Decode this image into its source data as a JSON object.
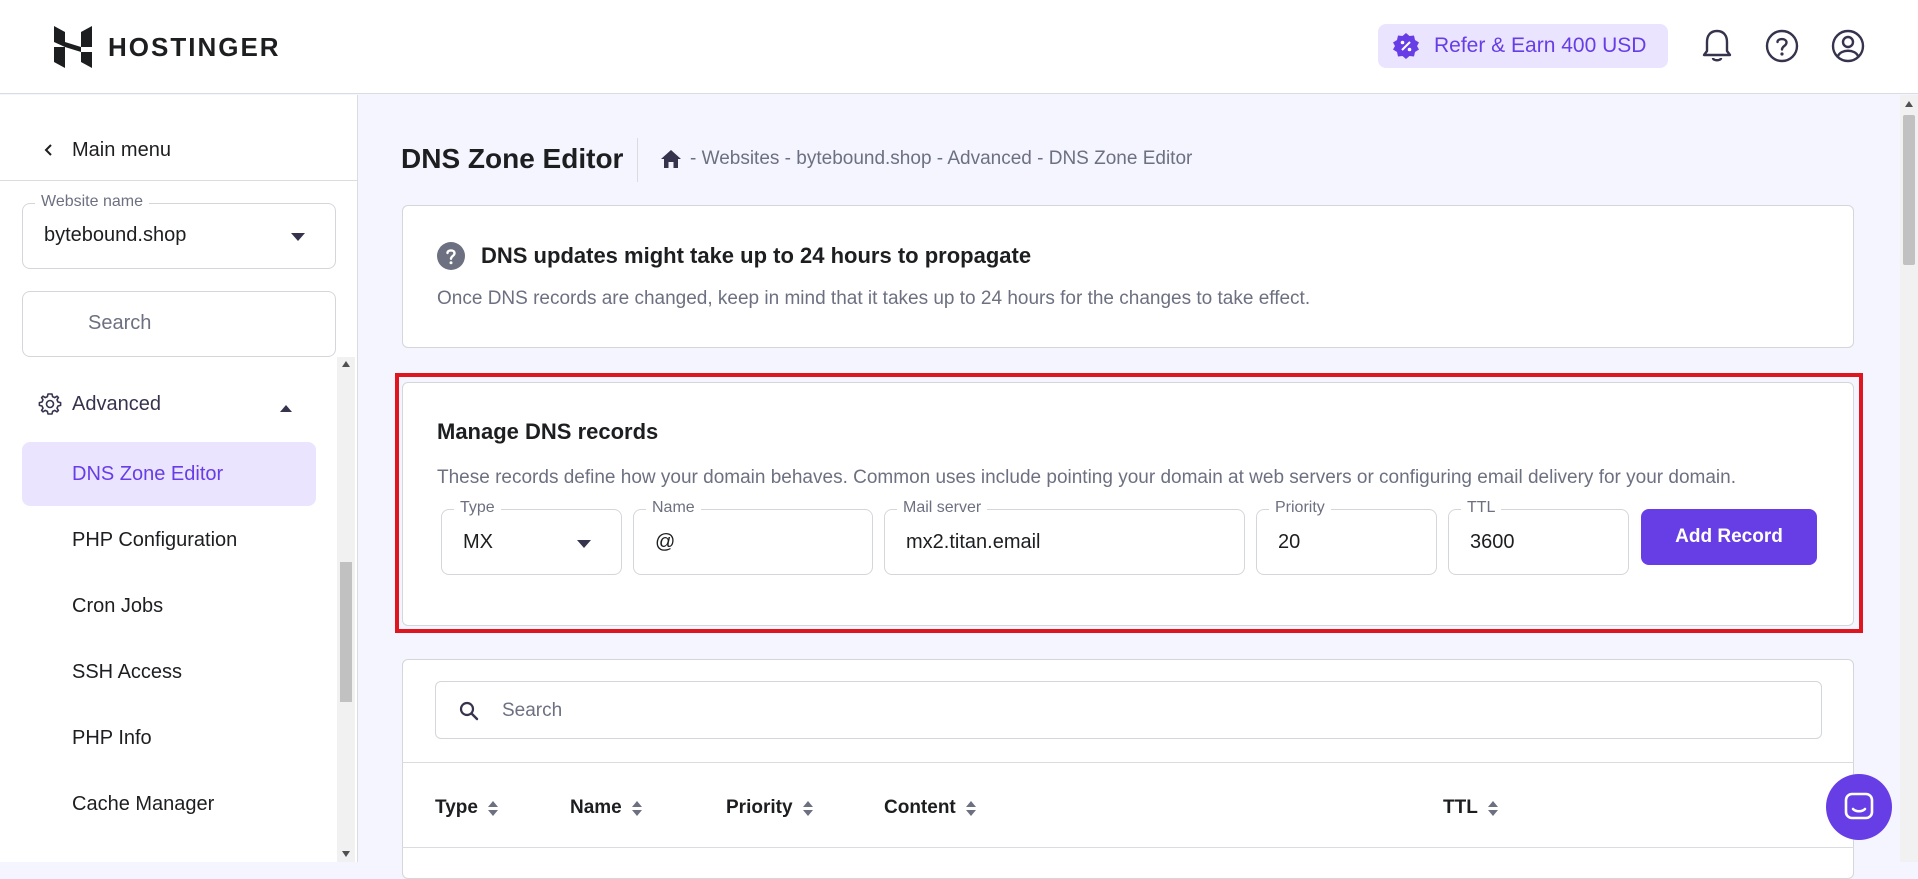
{
  "header": {
    "brand": "HOSTINGER",
    "refer_label": "Refer & Earn 400 USD"
  },
  "sidebar": {
    "main_menu_label": "Main menu",
    "website_field": {
      "label": "Website name",
      "value": "bytebound.shop"
    },
    "search_placeholder": "Search",
    "section_label": "Advanced",
    "items": [
      {
        "label": "DNS Zone Editor",
        "active": true
      },
      {
        "label": "PHP Configuration"
      },
      {
        "label": "Cron Jobs"
      },
      {
        "label": "SSH Access"
      },
      {
        "label": "PHP Info"
      },
      {
        "label": "Cache Manager"
      }
    ]
  },
  "page": {
    "title": "DNS Zone Editor",
    "breadcrumb": "- Websites - bytebound.shop - Advanced - DNS Zone Editor"
  },
  "info_card": {
    "title": "DNS updates might take up to 24 hours to propagate",
    "description": "Once DNS records are changed, keep in mind that it takes up to 24 hours for the changes to take effect."
  },
  "manage": {
    "title": "Manage DNS records",
    "description": "These records define how your domain behaves. Common uses include pointing your domain at web servers or configuring email delivery for your domain.",
    "fields": {
      "type": {
        "label": "Type",
        "value": "MX"
      },
      "name": {
        "label": "Name",
        "value": "@"
      },
      "mail_server": {
        "label": "Mail server",
        "value": "mx2.titan.email"
      },
      "priority": {
        "label": "Priority",
        "value": "20"
      },
      "ttl": {
        "label": "TTL",
        "value": "3600"
      }
    },
    "add_button": "Add Record"
  },
  "records": {
    "search_placeholder": "Search",
    "columns": [
      "Type",
      "Name",
      "Priority",
      "Content",
      "TTL"
    ]
  },
  "colors": {
    "accent": "#673de6",
    "accent_light": "#ebe4ff",
    "highlight": "#e0161f"
  }
}
